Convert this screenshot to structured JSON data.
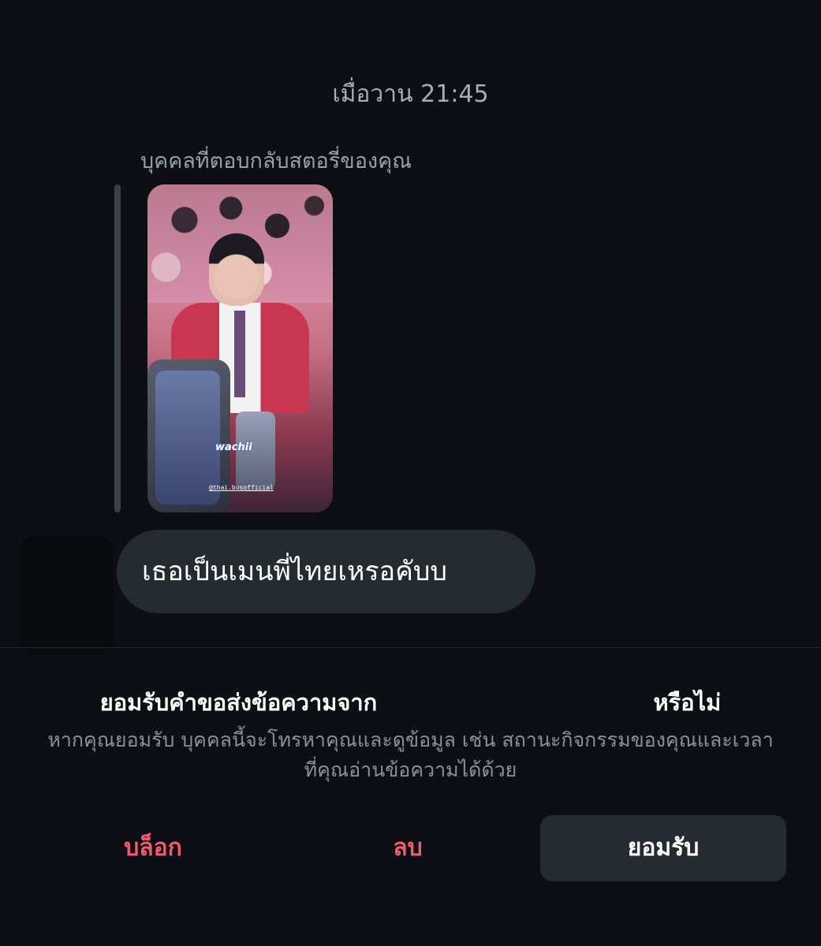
{
  "conversation": {
    "timestamp": "เมื่อวาน 21:45",
    "story_reply_label": "บุคคลที่ตอบกลับสตอรี่ของคุณ",
    "story": {
      "sticker_text": "wachii",
      "credit_text": "@thai.busofficial"
    },
    "message_text": "เธอเป็นเมนพี่ไทยเหรอคับบ"
  },
  "request": {
    "title_prefix": "ยอมรับคำขอส่งข้อความจาก",
    "title_suffix": "หรือไม่",
    "description": "หากคุณยอมรับ บุคคลนี้จะโทรหาคุณและดูข้อมูล เช่น สถานะกิจกรรมของคุณและเวลาที่คุณอ่านข้อความได้ด้วย"
  },
  "actions": {
    "block_label": "บล็อก",
    "delete_label": "ลบ",
    "accept_label": "ยอมรับ"
  },
  "colors": {
    "background": "#0d0f14",
    "bubble": "#262a31",
    "destructive": "#f25a6f",
    "secondary_text": "#8c9199"
  }
}
